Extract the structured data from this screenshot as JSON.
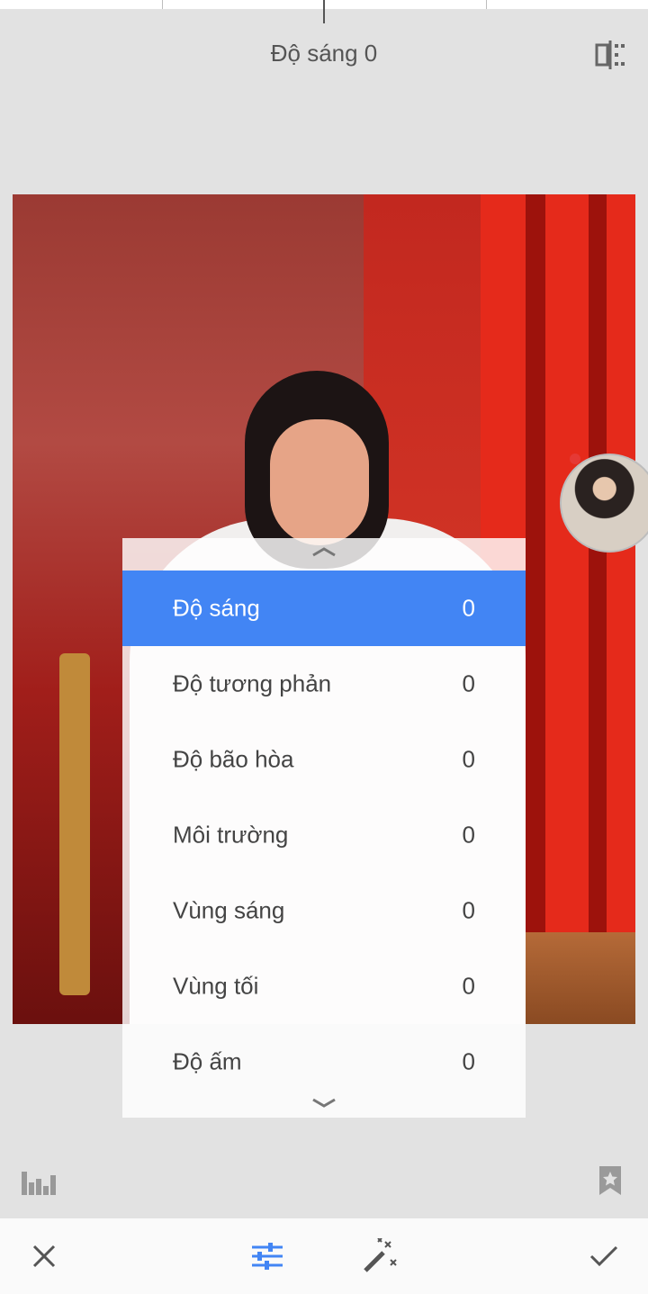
{
  "header": {
    "title": "Độ sáng 0"
  },
  "menu": {
    "items": [
      {
        "label": "Độ sáng",
        "value": "0"
      },
      {
        "label": "Độ tương phản",
        "value": "0"
      },
      {
        "label": "Độ bão hòa",
        "value": "0"
      },
      {
        "label": "Môi trường",
        "value": "0"
      },
      {
        "label": "Vùng sáng",
        "value": "0"
      },
      {
        "label": "Vùng tối",
        "value": "0"
      },
      {
        "label": "Độ ấm",
        "value": "0"
      }
    ],
    "selected": "Độ sáng"
  },
  "icons": {
    "compare": "compare-icon",
    "histogram": "histogram-icon",
    "styles": "bookmark-star-icon",
    "cancel": "close-icon",
    "adjust": "tune-sliders-icon",
    "auto": "magic-wand-icon",
    "apply": "check-icon"
  },
  "colors": {
    "accent": "#4285f4",
    "background": "#e2e2e2"
  }
}
